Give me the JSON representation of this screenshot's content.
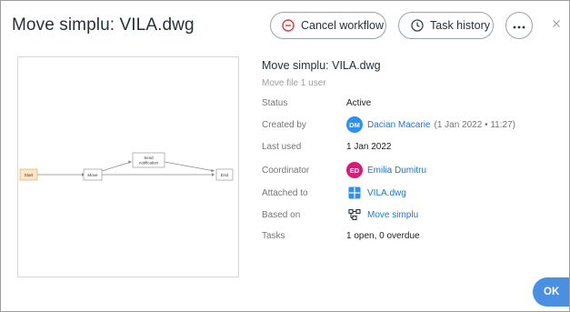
{
  "dialog": {
    "title": "Move simplu: VILA.dwg",
    "cancel_label": "Cancel workflow",
    "history_label": "Task history",
    "ok_label": "OK"
  },
  "diagram": {
    "start": "Start",
    "move": "Move",
    "notify_line1": "Send",
    "notify_line2": "notification",
    "end": "End"
  },
  "info": {
    "title": "Move simplu: VILA.dwg",
    "subtitle": "Move file 1 user",
    "rows": [
      {
        "key": "Status",
        "value": "Active"
      },
      {
        "key": "Created by",
        "avatar": "DM",
        "value": "Dacian Macarie",
        "extra": "(1 Jan 2022 • 11:27)"
      },
      {
        "key": "Last used",
        "value": "1 Jan 2022"
      },
      {
        "key": "Coordinator",
        "avatar": "ED",
        "value": "Emilia Dumitru"
      },
      {
        "key": "Attached to",
        "icon": "dwg-file-icon",
        "value": "VILA.dwg"
      },
      {
        "key": "Based on",
        "icon": "workflow-icon",
        "value": "Move simplu"
      },
      {
        "key": "Tasks",
        "value": "1 open, 0 overdue"
      }
    ]
  },
  "colors": {
    "accent": "#4a90e2",
    "link": "#1976d2",
    "avatar_dm": "#2f8ff2",
    "avatar_ed": "#d81b75",
    "cancel_icon": "#e53935",
    "start_fill": "#fde7c8"
  }
}
